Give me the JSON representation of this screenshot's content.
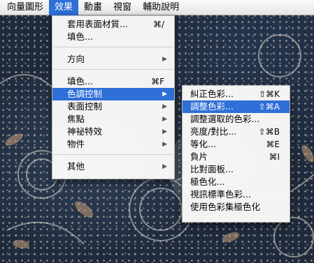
{
  "menubar": {
    "items": [
      "向量圖形",
      "效果",
      "動畫",
      "視窗",
      "輔助說明"
    ]
  },
  "main_menu": {
    "items": [
      {
        "label": "套用表面材質...",
        "shortcut": "⌘/"
      },
      {
        "label": "填色..."
      },
      {
        "label": "方向"
      },
      {
        "label": "填色...",
        "shortcut": "⌘F"
      },
      {
        "label": "色調控制"
      },
      {
        "label": "表面控制"
      },
      {
        "label": "焦點"
      },
      {
        "label": "神祕特效"
      },
      {
        "label": "物件"
      },
      {
        "label": "其他"
      }
    ]
  },
  "sub_menu": {
    "items": [
      {
        "label": "糾正色彩...",
        "shortcut": "⇧⌘K"
      },
      {
        "label": "調整色彩...",
        "shortcut": "⇧⌘A"
      },
      {
        "label": "調整選取的色彩..."
      },
      {
        "label": "亮度/對比...",
        "shortcut": "⇧⌘B"
      },
      {
        "label": "等化...",
        "shortcut": "⌘E"
      },
      {
        "label": "負片",
        "shortcut": "⌘I"
      },
      {
        "label": "比對面板..."
      },
      {
        "label": "極色化..."
      },
      {
        "label": "視訊標準色彩..."
      },
      {
        "label": "使用色彩集極色化"
      }
    ]
  },
  "colors": {
    "highlight": "#2f6fd8",
    "fabric": "#1f2a3c"
  },
  "icons": {
    "submenu_arrow": "▶"
  }
}
